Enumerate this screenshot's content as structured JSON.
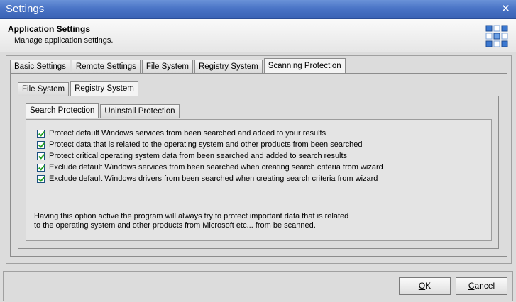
{
  "window": {
    "title": "Settings",
    "close_glyph": "✕"
  },
  "header": {
    "title": "Application Settings",
    "subtitle": "Manage application settings.",
    "logo_icon": "grid-logo-icon"
  },
  "main_tabs": [
    {
      "label": "Basic Settings",
      "active": false
    },
    {
      "label": "Remote Settings",
      "active": false
    },
    {
      "label": "File System",
      "active": false
    },
    {
      "label": "Registry System",
      "active": false
    },
    {
      "label": "Scanning Protection",
      "active": true
    }
  ],
  "sub_tabs": [
    {
      "label": "File System",
      "active": false
    },
    {
      "label": "Registry System",
      "active": true
    }
  ],
  "inner_tabs": [
    {
      "label": "Search Protection",
      "active": true
    },
    {
      "label": "Uninstall Protection",
      "active": false
    }
  ],
  "options": [
    {
      "label": "Protect default Windows services from been searched and added to your results",
      "checked": true
    },
    {
      "label": "Protect data that is related to the operating system and other products from been searched",
      "checked": true
    },
    {
      "label": "Protect critical operating system data from been searched and added to search results",
      "checked": true
    },
    {
      "label": "Exclude default Windows services from been searched when creating search criteria from wizard",
      "checked": true
    },
    {
      "label": "Exclude default Windows drivers from been searched when creating search criteria from wizard",
      "checked": true
    }
  ],
  "note": {
    "line1": "Having this option active the program will always try to protect important data that is related",
    "line2": "to the operating system and other products from Microsoft etc... from be scanned."
  },
  "buttons": {
    "ok_prefix": "O",
    "ok_rest": "K",
    "cancel_prefix": "C",
    "cancel_rest": "ancel"
  },
  "colors": {
    "titlebar": "#4a74c6",
    "check": "#21a121"
  }
}
